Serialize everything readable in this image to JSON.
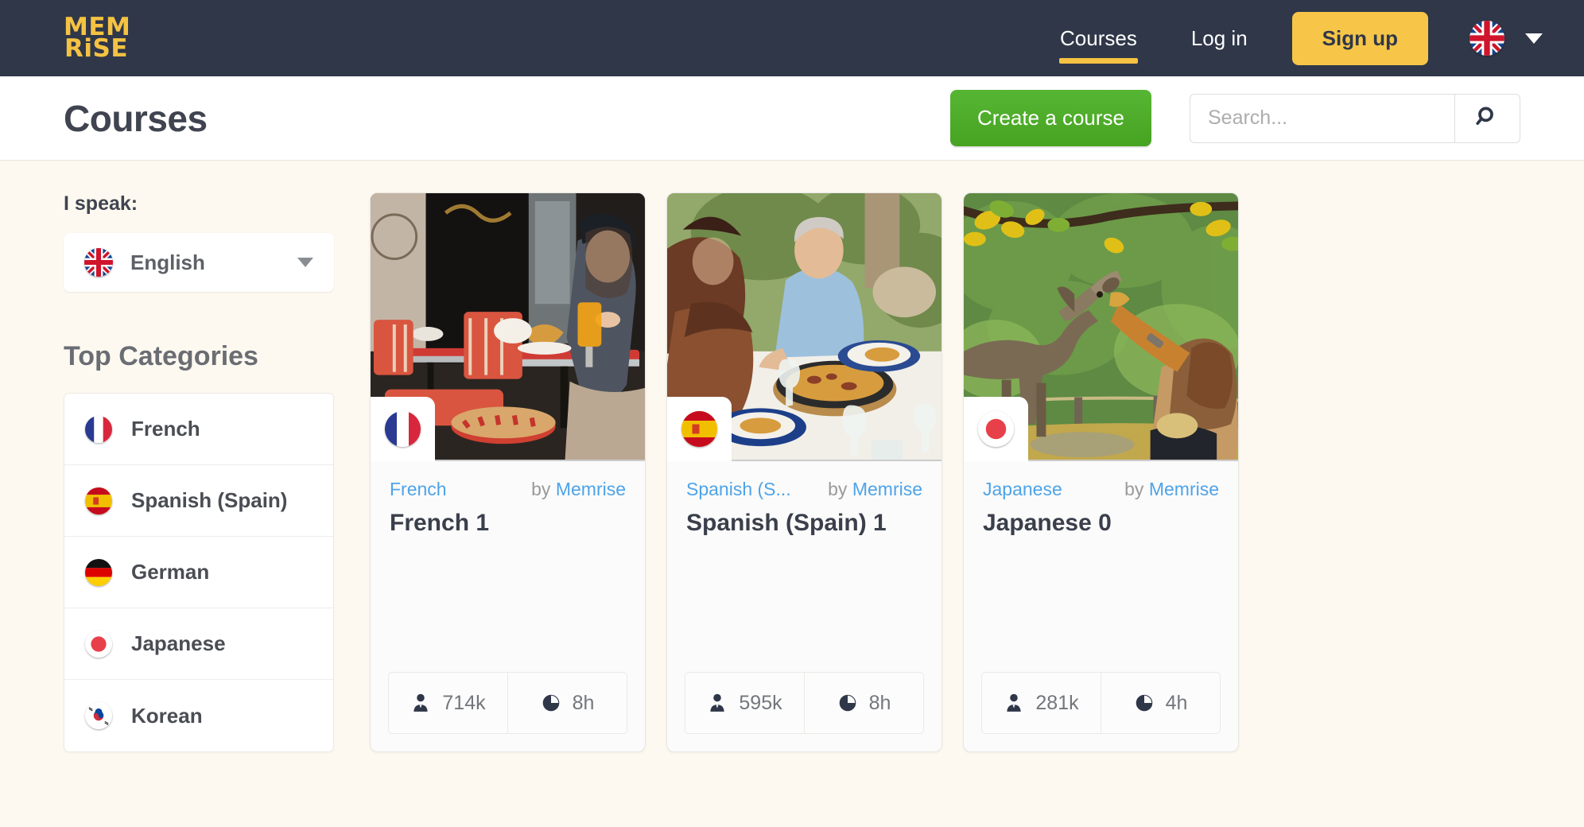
{
  "nav": {
    "logo_line1": "MEM",
    "logo_line2": "RiSE",
    "links": [
      {
        "label": "Courses",
        "active": true
      },
      {
        "label": "Log in",
        "active": false
      }
    ],
    "signup_label": "Sign up",
    "language_flag": "uk-flag-icon",
    "caret": "chevron-down-icon"
  },
  "header": {
    "title": "Courses",
    "create_label": "Create a course",
    "search_placeholder": "Search...",
    "search_value": "",
    "search_icon": "search-icon"
  },
  "sidebar": {
    "speak_label": "I speak:",
    "speak_value": "English",
    "speak_flag": "uk-flag-icon",
    "categories_title": "Top Categories",
    "categories": [
      {
        "label": "French",
        "flag": "france-flag-icon"
      },
      {
        "label": "Spanish (Spain)",
        "flag": "spain-flag-icon"
      },
      {
        "label": "German",
        "flag": "germany-flag-icon"
      },
      {
        "label": "Japanese",
        "flag": "japan-flag-icon"
      },
      {
        "label": "Korean",
        "flag": "korea-flag-icon"
      }
    ]
  },
  "courses": [
    {
      "category": "French",
      "by_prefix": "by",
      "author": "Memrise",
      "title": "French 1",
      "learners": "714k",
      "duration": "8h",
      "flag": "france-flag-icon",
      "learners_icon": "person-icon",
      "duration_icon": "clock-icon"
    },
    {
      "category": "Spanish (S...",
      "by_prefix": "by",
      "author": "Memrise",
      "title": "Spanish (Spain) 1",
      "learners": "595k",
      "duration": "8h",
      "flag": "spain-flag-icon",
      "learners_icon": "person-icon",
      "duration_icon": "clock-icon"
    },
    {
      "category": "Japanese",
      "by_prefix": "by",
      "author": "Memrise",
      "title": "Japanese 0",
      "learners": "281k",
      "duration": "4h",
      "flag": "japan-flag-icon",
      "learners_icon": "person-icon",
      "duration_icon": "clock-icon"
    }
  ],
  "colors": {
    "nav_bg": "#2f3749",
    "brand_yellow": "#f5c242",
    "create_green": "#4caf28",
    "link_blue": "#4ea3e8",
    "page_bg": "#fdf9f0"
  }
}
